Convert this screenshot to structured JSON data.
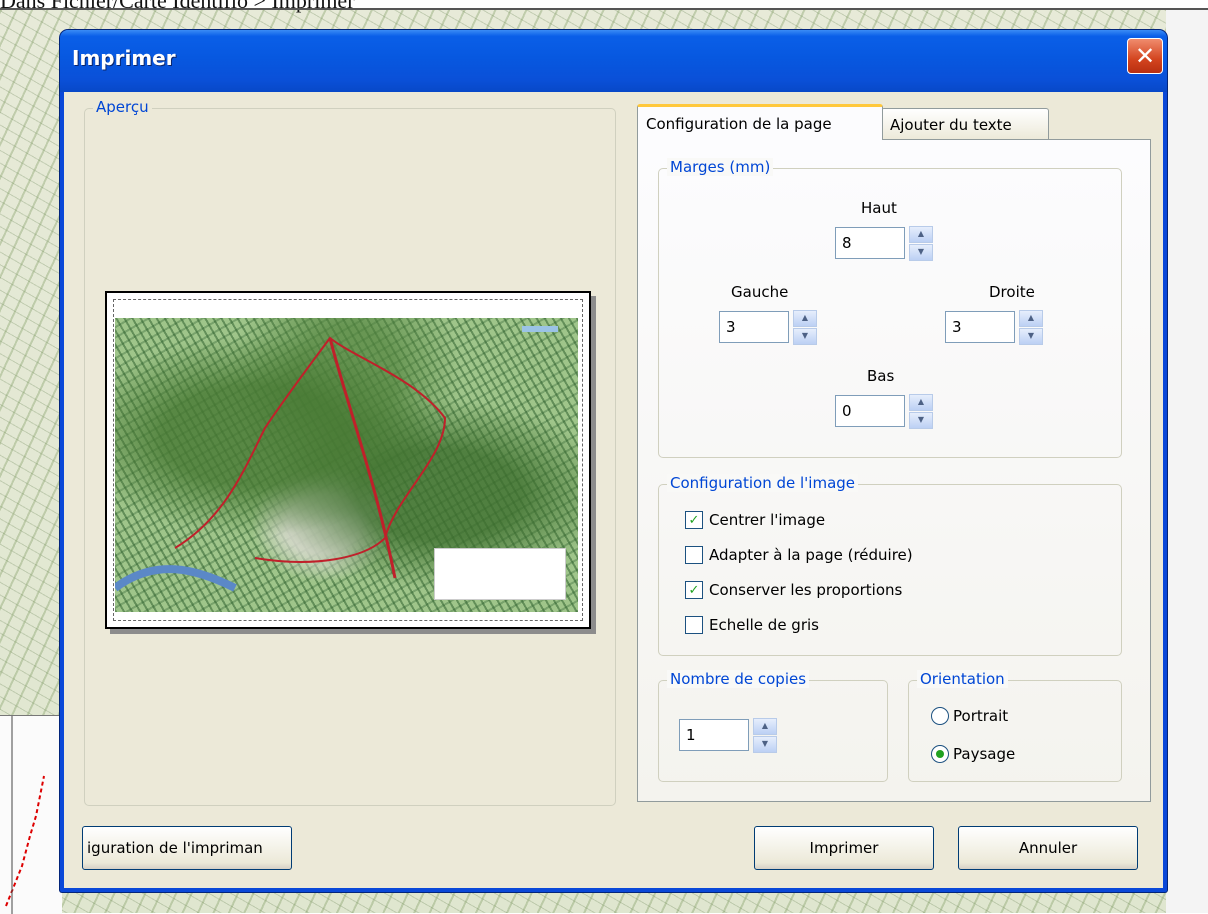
{
  "background": {
    "caption": "Dans Fichier/Carte Identifio > Imprimer"
  },
  "dialog": {
    "title": "Imprimer",
    "close_label": "✕"
  },
  "preview": {
    "label": "Aperçu"
  },
  "tabs": [
    {
      "label": "Configuration de la page",
      "active": true
    },
    {
      "label": "Ajouter du texte",
      "active": false
    }
  ],
  "margins": {
    "label": "Marges (mm)",
    "top": {
      "label": "Haut",
      "value": "8"
    },
    "left": {
      "label": "Gauche",
      "value": "3"
    },
    "right": {
      "label": "Droite",
      "value": "3"
    },
    "bottom": {
      "label": "Bas",
      "value": "0"
    }
  },
  "image_config": {
    "label": "Configuration de l'image",
    "options": [
      {
        "label": "Centrer l'image",
        "checked": true
      },
      {
        "label": "Adapter à la page (réduire)",
        "checked": false
      },
      {
        "label": "Conserver les proportions",
        "checked": true
      },
      {
        "label": "Echelle de gris",
        "checked": false
      }
    ]
  },
  "copies": {
    "label": "Nombre de copies",
    "value": "1"
  },
  "orientation": {
    "label": "Orientation",
    "options": [
      {
        "label": "Portrait",
        "selected": false
      },
      {
        "label": "Paysage",
        "selected": true
      }
    ]
  },
  "buttons": {
    "printer_setup": "iguration de l'impriman",
    "print": "Imprimer",
    "cancel": "Annuler"
  },
  "icons": {
    "check": "✓",
    "up": "▲",
    "down": "▼"
  },
  "colors": {
    "titlebar": "#0a5fe8",
    "group_label": "#0046d5",
    "dialog_bg": "#ece9d8"
  }
}
